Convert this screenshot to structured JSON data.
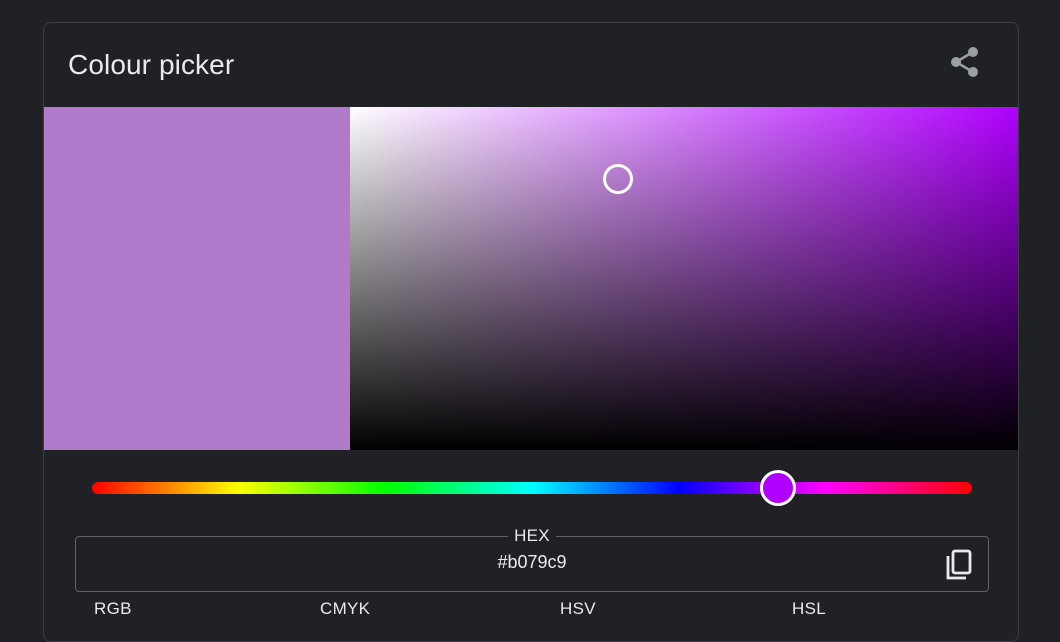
{
  "picker": {
    "title": "Colour picker",
    "selected_color": "#b079c9",
    "hue_color": "#b000ff",
    "hue_fraction": 0.78,
    "saturation_fraction": 0.4,
    "value_fraction": 0.79
  },
  "hex": {
    "label": "HEX",
    "value": "#b079c9"
  },
  "formats": [
    {
      "label": "RGB"
    },
    {
      "label": "CMYK"
    },
    {
      "label": "HSV"
    },
    {
      "label": "HSL"
    }
  ],
  "icons": {
    "share": "share-icon",
    "copy": "copy-icon"
  }
}
